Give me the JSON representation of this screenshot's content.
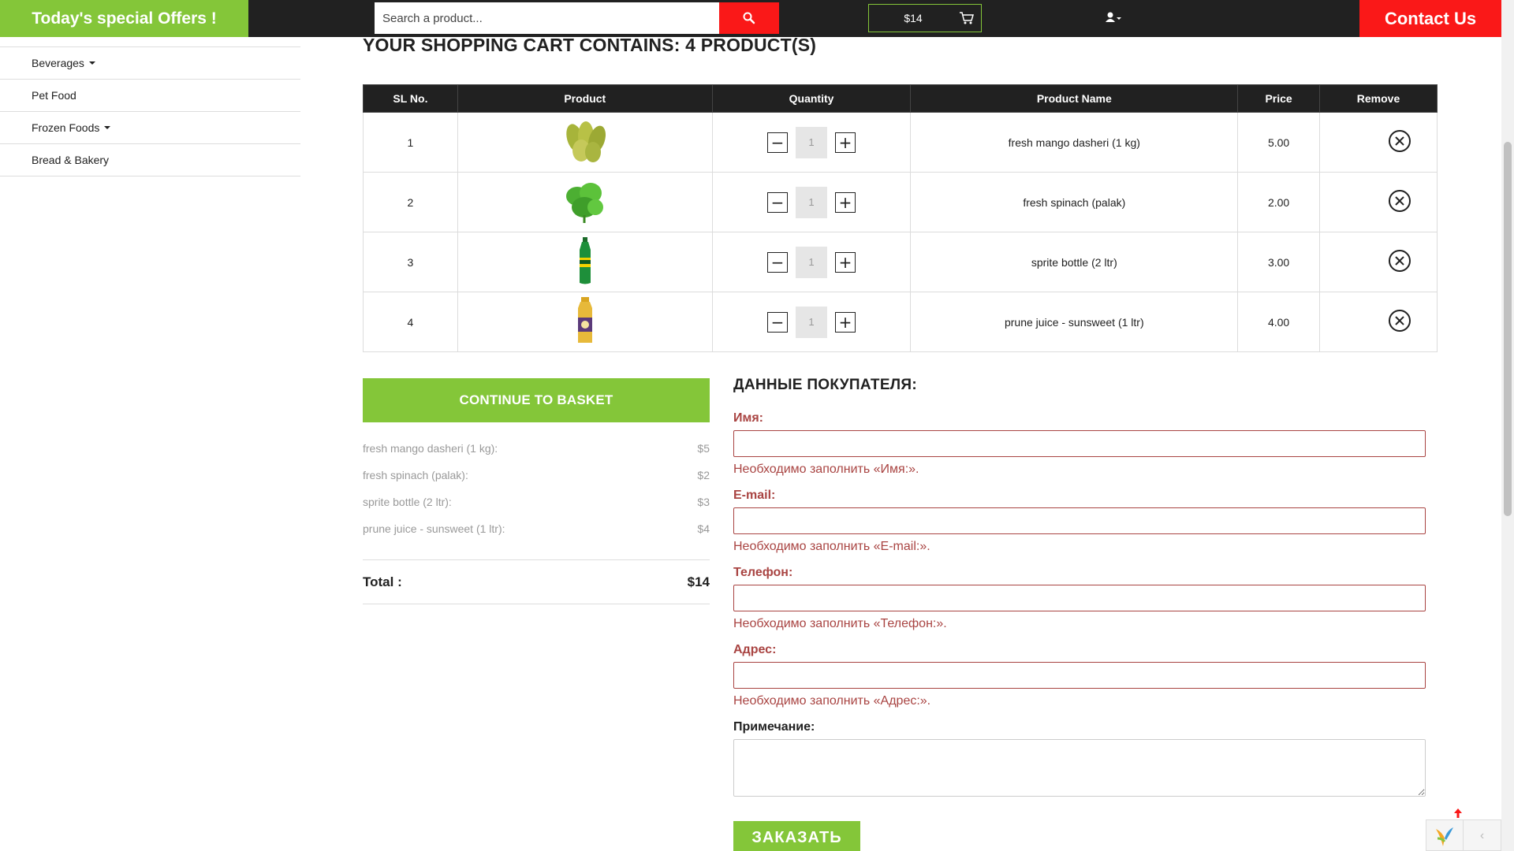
{
  "topbar": {
    "offers_label": "Today's special Offers !",
    "search_placeholder": "Search a product...",
    "cart_total": "$14",
    "contact_label": "Contact Us"
  },
  "sidebar": {
    "items": [
      {
        "label": "Beverages",
        "dropdown": true
      },
      {
        "label": "Pet Food",
        "dropdown": false
      },
      {
        "label": "Frozen Foods",
        "dropdown": true
      },
      {
        "label": "Bread & Bakery",
        "dropdown": false
      }
    ]
  },
  "cart": {
    "heading": "YOUR SHOPPING CART CONTAINS: 4 PRODUCT(S)",
    "columns": [
      "SL No.",
      "Product",
      "Quantity",
      "Product Name",
      "Price",
      "Remove"
    ],
    "rows": [
      {
        "sl": "1",
        "qty": "1",
        "name": "fresh mango dasheri (1 kg)",
        "price": "5.00",
        "image": "mango-image"
      },
      {
        "sl": "2",
        "qty": "1",
        "name": "fresh spinach (palak)",
        "price": "2.00",
        "image": "spinach-image"
      },
      {
        "sl": "3",
        "qty": "1",
        "name": "sprite bottle (2 ltr)",
        "price": "3.00",
        "image": "sprite-bottle-image"
      },
      {
        "sl": "4",
        "qty": "1",
        "name": "prune juice - sunsweet (1 ltr)",
        "price": "4.00",
        "image": "prune-juice-image"
      }
    ]
  },
  "summary": {
    "continue_label": "CONTINUE TO BASKET",
    "items": [
      {
        "name": "fresh mango dasheri (1 kg):",
        "price": "$5"
      },
      {
        "name": "fresh spinach (palak):",
        "price": "$2"
      },
      {
        "name": "sprite bottle (2 ltr):",
        "price": "$3"
      },
      {
        "name": "prune juice - sunsweet (1 ltr):",
        "price": "$4"
      }
    ],
    "total_label": "Total :",
    "total_value": "$14"
  },
  "form": {
    "title": "ДАННЫЕ ПОКУПАТЕЛЯ:",
    "fields": [
      {
        "label": "Имя:",
        "error": "Необходимо заполнить «Имя:»."
      },
      {
        "label": "E-mail:",
        "error": "Необходимо заполнить «E-mail:»."
      },
      {
        "label": "Телефон:",
        "error": "Необходимо заполнить «Телефон:»."
      },
      {
        "label": "Адрес:",
        "error": "Необходимо заполнить «Адрес:»."
      }
    ],
    "note_label": "Примечание:",
    "submit_label": "ЗАКАЗАТЬ"
  },
  "colors": {
    "accent_green": "#84c639",
    "accent_red": "#fa1818",
    "dark": "#212121",
    "error": "#a94442"
  }
}
